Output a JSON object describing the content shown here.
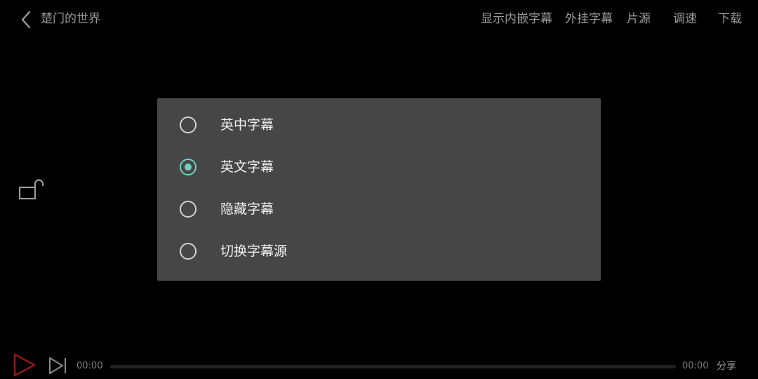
{
  "header": {
    "back_icon": "chevron-left-icon",
    "title": "楚门的世界",
    "actions": [
      {
        "label": "显示内嵌字幕"
      },
      {
        "label": "外挂字幕"
      },
      {
        "label": "片源"
      },
      {
        "label": "调速"
      },
      {
        "label": "下载"
      }
    ]
  },
  "side": {
    "lock_icon": "unlock-icon"
  },
  "subtitle_dialog": {
    "options": [
      {
        "label": "英中字幕",
        "selected": false
      },
      {
        "label": "英文字幕",
        "selected": true
      },
      {
        "label": "隐藏字幕",
        "selected": false
      },
      {
        "label": "切换字幕源",
        "selected": false
      }
    ],
    "accent_color": "#6fd0bd",
    "background_color": "#464646"
  },
  "player": {
    "play_icon": "play-icon",
    "next_icon": "skip-next-icon",
    "current_time": "00:00",
    "total_time": "00:00",
    "progress": 0,
    "share_label": "分享",
    "play_icon_color": "#8b1a1a"
  }
}
